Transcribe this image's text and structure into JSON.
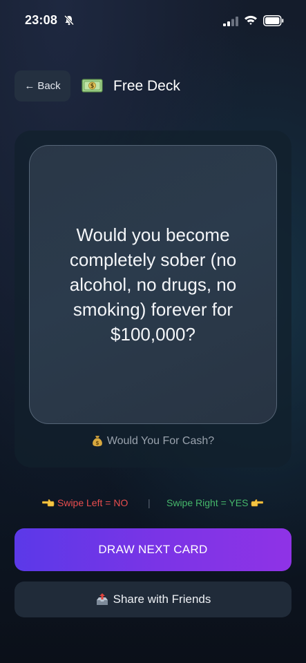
{
  "status_bar": {
    "time": "23:08",
    "icons": [
      "bell-slash-icon",
      "signal-icon",
      "wifi-icon",
      "battery-icon"
    ]
  },
  "header": {
    "back_label": "Back",
    "back_arrow": "←",
    "deck_icon": "money-bill-icon",
    "deck_title": "Free Deck"
  },
  "card": {
    "question": "Would you become completely sober (no alcohol, no drugs, no smoking) forever for $100,000?",
    "category_icon": "money-bag-icon",
    "category": "Would You For Cash?"
  },
  "swipe_hint": {
    "left": "Swipe Left = NO",
    "divider": "|",
    "right": "Swipe Right = YES",
    "left_color": "#ea4e4e",
    "right_color": "#46b86b"
  },
  "actions": {
    "draw_label": "DRAW NEXT CARD",
    "share_label": "Share with Friends",
    "accent_start": "#5b39e8",
    "accent_end": "#8f33e6"
  }
}
